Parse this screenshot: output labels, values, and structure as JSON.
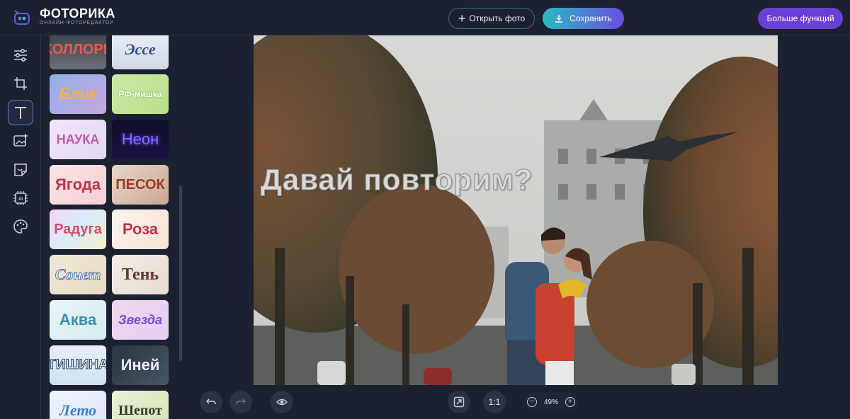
{
  "app": {
    "title": "ФОТОРИКА",
    "subtitle": "ОНЛАЙН-ФОТОРЕДАКТОР"
  },
  "header": {
    "open_label": "Открыть фото",
    "save_label": "Сохранить",
    "more_label": "Больше функций"
  },
  "tools": [
    {
      "name": "adjust-icon"
    },
    {
      "name": "crop-icon"
    },
    {
      "name": "text-icon",
      "active": true
    },
    {
      "name": "add-image-icon"
    },
    {
      "name": "sticker-icon"
    },
    {
      "name": "ai-icon"
    },
    {
      "name": "palette-icon"
    }
  ],
  "presets": [
    {
      "label": "ХОЛЛОРЕ",
      "color": "#e85a4a"
    },
    {
      "label": "Эссе",
      "color": "#3a4d8f"
    },
    {
      "label": "Блик",
      "color": "#f4b34a"
    },
    {
      "label": "РФ-мишка",
      "color": "#ffffff"
    },
    {
      "label": "НАУКА",
      "color": "#c25a9f"
    },
    {
      "label": "Неон",
      "color": "#8a6bff"
    },
    {
      "label": "Ягода",
      "color": "#c0334a"
    },
    {
      "label": "ПЕСОК",
      "color": "#9b3a2a"
    },
    {
      "label": "Радуга",
      "color": "#d94a6a"
    },
    {
      "label": "Роза",
      "color": "#c0334a"
    },
    {
      "label": "Сонет",
      "color": "#e9eef7"
    },
    {
      "label": "Тень",
      "color": "#6a3a2c"
    },
    {
      "label": "Аква",
      "color": "#3a8fb0"
    },
    {
      "label": "Звезда",
      "color": "#7a4ad6"
    },
    {
      "label": "ТИШИНА",
      "color": "#f2f2f2"
    },
    {
      "label": "Иней",
      "color": "#e8eef5"
    },
    {
      "label": "Лето",
      "color": "#3a7fd6"
    },
    {
      "label": "Шепот",
      "color": "#2f3e2a"
    }
  ],
  "canvas": {
    "text": "Давай повторим?"
  },
  "bottombar": {
    "ratio_label": "1:1",
    "zoom_value": "49%"
  },
  "colors": {
    "accent": "#6a3fd6",
    "save_gradient_start": "#2bb8c3",
    "background": "#1b2130"
  }
}
